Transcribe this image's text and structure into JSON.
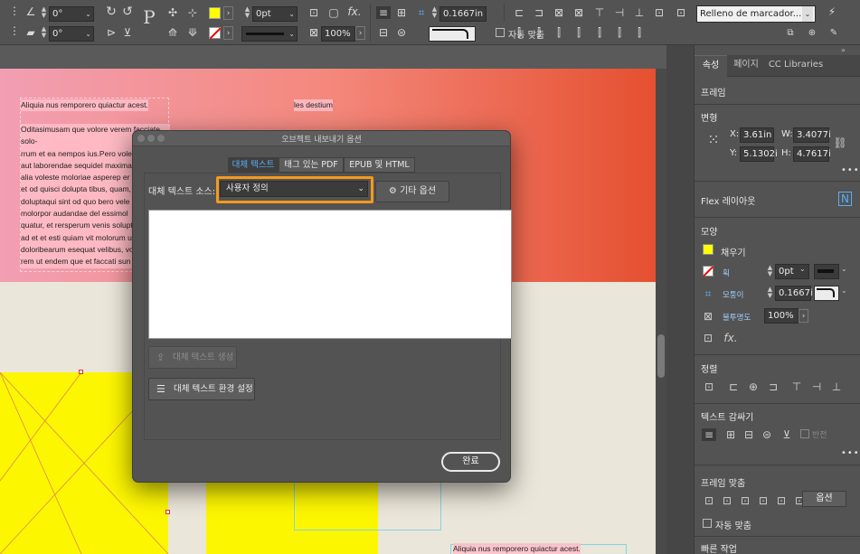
{
  "control_bar": {
    "angle_1": "0°",
    "angle_2": "0°",
    "stroke_weight": "0pt",
    "opacity": "100%",
    "offset": "0.1667in",
    "style_dropdown": "Relleno de marcador...",
    "auto_fit_label": "자동 맞춤",
    "fx_label": "fx.",
    "p_glyph": "P"
  },
  "page": {
    "text_top_left": "Aliquia nus remporero quiactur acest.",
    "text_top_center": "les destium",
    "paragraph": [
      "Oditasimusam que volore verem facciate solo-",
      "rrum et ea nempos ius.Pero volendi",
      "aut laborendae sequidel maximagn",
      "alia voleste moloriae asperep er",
      "et od quisci dolupta tibus, quam,",
      "doluptaqui sint od quo bero vele",
      "molorpor audandae del essimol",
      "quatur, et rersperum venis solupt",
      "ad et et esti quiam vit molorum uta",
      "doloribearum esequat velibus, vole",
      "rem ut endem que et faccati sun"
    ],
    "text_bottom": "Aliquia nus remporero quiactur acest."
  },
  "dialog": {
    "title": "오브젝트 내보내기 옵션",
    "tabs": [
      {
        "label": "대체 텍스트",
        "active": true
      },
      {
        "label": "태그 있는 PDF",
        "active": false
      },
      {
        "label": "EPUB 및 HTML",
        "active": false
      }
    ],
    "source_label": "대체 텍스트 소스:",
    "source_value": "사용자 정의",
    "other_options": "기타 옵션",
    "generate_button": "대체 텍스트 생성",
    "settings_button": "대체 텍스트 환경 설정",
    "done_button": "완료"
  },
  "right_panel": {
    "tabs": [
      {
        "label": "속성",
        "active": true
      },
      {
        "label": "페이지",
        "active": false
      },
      {
        "label": "CC Libraries",
        "active": false
      }
    ],
    "frame_header": "프레임",
    "transform_header": "변형",
    "x_label": "X:",
    "x_value": "3.61in",
    "y_label": "Y:",
    "y_value": "5.1302i",
    "w_label": "W:",
    "w_value": "3.4077i",
    "h_label": "H:",
    "h_value": "4.7617i",
    "flex_header": "Flex 레이아웃",
    "appearance_header": "모양",
    "fill_label": "채우기",
    "stroke_label": "획",
    "stroke_value": "0pt",
    "corner_label": "모퉁이",
    "corner_value": "0.1667i",
    "opacity_label": "불투명도",
    "opacity_value": "100%",
    "fx_label": "fx.",
    "align_header": "정렬",
    "text_wrap_header": "텍스트 감싸기",
    "invert_label": "반전",
    "frame_fit_header": "프레임 맞춤",
    "options_button": "옵션",
    "auto_fit_label": "자동 맞춤",
    "quick_actions_header": "빠른 작업",
    "accent_color": "#f39a1e",
    "fill_color": "#ffff00"
  }
}
